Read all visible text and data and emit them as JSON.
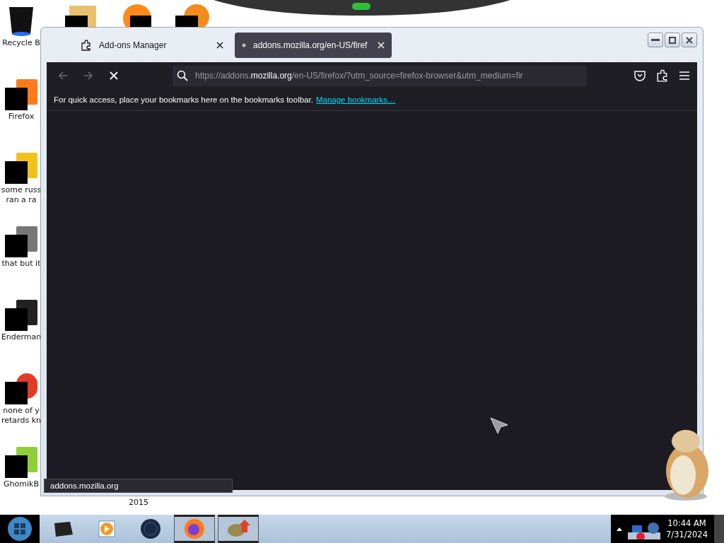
{
  "desktop_icons": [
    {
      "kind": "bin",
      "lines": [
        "Recycle B"
      ]
    },
    {
      "kind": "firefox",
      "lines": [
        "Firefox"
      ]
    },
    {
      "kind": "yellow",
      "lines": [
        "some russ",
        "ran a ra"
      ]
    },
    {
      "kind": "stack",
      "lines": [
        "that but it"
      ]
    },
    {
      "kind": "window",
      "lines": [
        "Enderman"
      ]
    },
    {
      "kind": "ring",
      "lines": [
        "none of y",
        "retards kn"
      ]
    },
    {
      "kind": "green",
      "lines": [
        "GhomikB"
      ]
    }
  ],
  "stray_label": "2015",
  "window": {
    "tabs": [
      {
        "kind": "addons",
        "label": "Add-ons Manager",
        "selected": false
      },
      {
        "kind": "loading",
        "label": "addons.mozilla.org/en-US/firef",
        "selected": true
      }
    ],
    "nav": {
      "back_disabled": true,
      "forward_disabled": true
    },
    "url": {
      "prefix": "https://addons.",
      "domain": "mozilla.org",
      "rest": "/en-US/firefox/?utm_source=firefox-browser&utm_medium=fir"
    },
    "bookmarks_bar": {
      "message": "For quick access, place your bookmarks here on the bookmarks toolbar.",
      "link": "Manage bookmarks…"
    },
    "status": "addons.mozilla.org"
  },
  "taskbar": {
    "items": [
      {
        "kind": "terminal",
        "selected": false
      },
      {
        "kind": "media",
        "selected": false
      },
      {
        "kind": "globe",
        "selected": false
      },
      {
        "kind": "firefox",
        "selected": true
      },
      {
        "kind": "game",
        "selected": true
      }
    ],
    "time": "10:44 AM",
    "date": "7/31/2024"
  }
}
